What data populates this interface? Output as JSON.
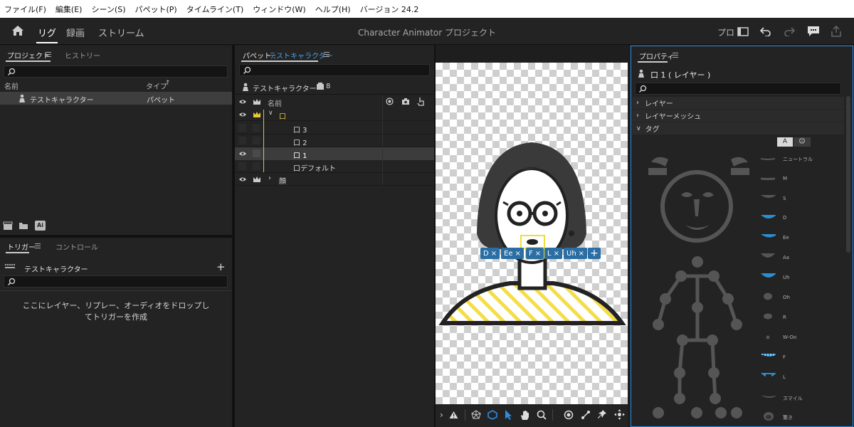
{
  "menu": {
    "items": [
      "ファイル(F)",
      "編集(E)",
      "シーン(S)",
      "パペット(P)",
      "タイムライン(T)",
      "ウィンドウ(W)",
      "ヘルプ(H)",
      "バージョン 24.2"
    ]
  },
  "appbar": {
    "tabs": [
      "リグ",
      "録画",
      "ストリーム"
    ],
    "title": "Character Animator プロジェクト",
    "right_label": "プロ"
  },
  "project_panel": {
    "tabs": [
      "プロジェクト",
      "ヒストリー"
    ],
    "col_name": "名前",
    "col_type": "タイプ",
    "item_name": "テストキャラクター",
    "item_type": "パペット",
    "ai_badge": "Ai"
  },
  "trigger_panel": {
    "tabs": [
      "トリガー",
      "コントロール"
    ],
    "puppet": "テストキャラクター",
    "empty_line1": "ここにレイヤー、リプレー、オーディオをドロップし",
    "empty_line2": "てトリガーを作成"
  },
  "puppet_panel": {
    "title_prefix": "パペット : ",
    "title_name": "テストキャラクター",
    "puppet_name": "テストキャラクター",
    "layer_count": "8",
    "col_name": "名前",
    "layers": [
      {
        "name": "口"
      },
      {
        "name": "口 3"
      },
      {
        "name": "口 2"
      },
      {
        "name": "口 1"
      },
      {
        "name": "口デフォルト"
      },
      {
        "name": "顔"
      }
    ]
  },
  "scene": {
    "tag_chips": [
      "D",
      "Ee",
      "F",
      "L",
      "Uh"
    ]
  },
  "properties": {
    "title": "プロパティ",
    "layer_name": "口 1 ( レイヤー )",
    "sections": [
      "レイヤー",
      "レイヤーメッシュ",
      "タグ"
    ],
    "toggle_a": "A",
    "mouth_tags": [
      "ニュートラル",
      "M",
      "S",
      "D",
      "Ee",
      "Aa",
      "Uh",
      "Oh",
      "R",
      "W-Oo",
      "F",
      "L",
      "スマイル",
      "驚き"
    ]
  },
  "colors": {
    "accent": "#2a6ea4",
    "highlight": "#f0dc3c",
    "stripe": "#f5dd48",
    "panel_border": "#2d8ce0"
  }
}
